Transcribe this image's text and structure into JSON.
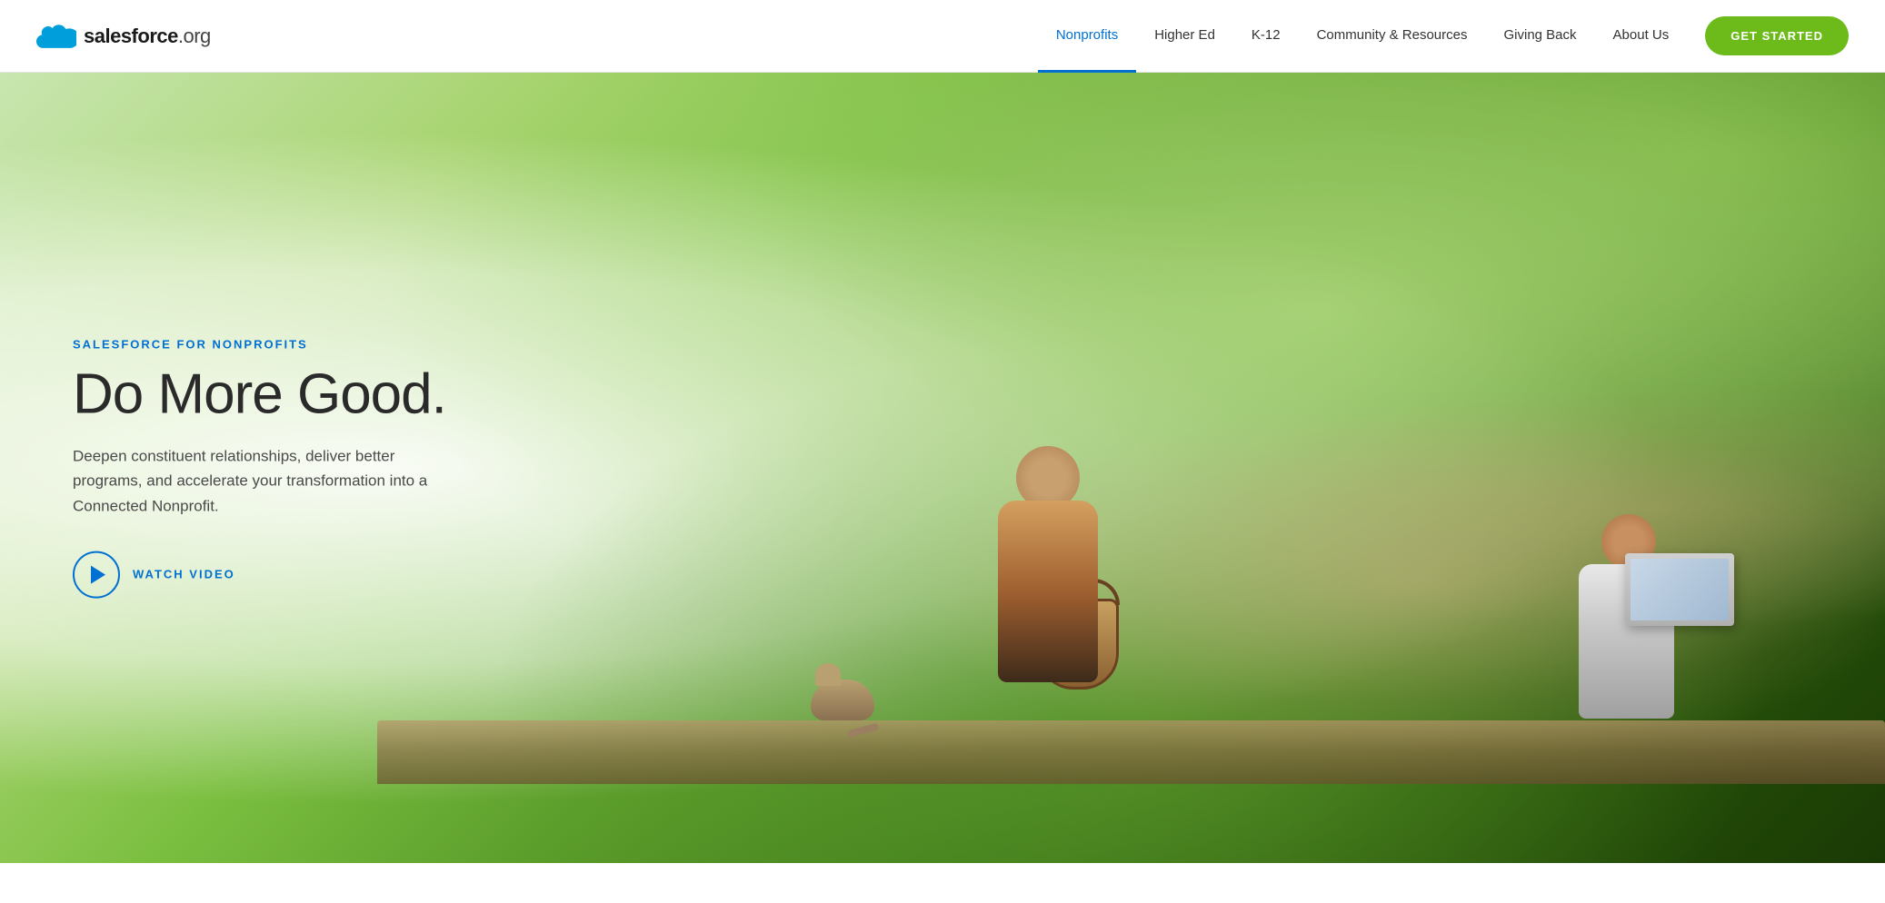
{
  "header": {
    "logo": {
      "text_salesforce": "salesforce",
      "text_org": ".org"
    },
    "nav": {
      "items": [
        {
          "label": "Nonprofits",
          "active": true
        },
        {
          "label": "Higher Ed",
          "active": false
        },
        {
          "label": "K-12",
          "active": false
        },
        {
          "label": "Community & Resources",
          "active": false
        },
        {
          "label": "Giving Back",
          "active": false
        },
        {
          "label": "About Us",
          "active": false
        }
      ],
      "cta_label": "GET STARTED"
    }
  },
  "hero": {
    "eyebrow": "SALESFORCE FOR NONPROFITS",
    "title": "Do More Good.",
    "subtitle": "Deepen constituent relationships, deliver better programs, and accelerate your transformation into a Connected Nonprofit.",
    "watch_video_label": "WATCH VIDEO"
  }
}
